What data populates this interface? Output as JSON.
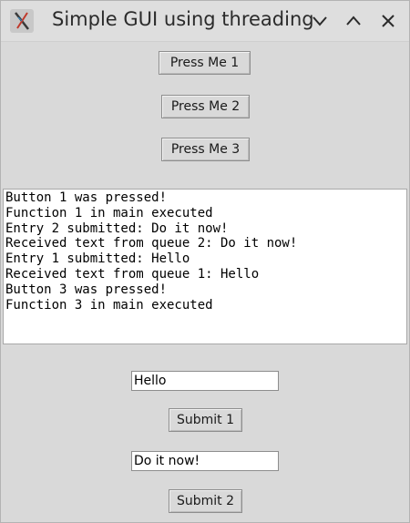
{
  "window": {
    "title": "Simple GUI using threading"
  },
  "buttons": {
    "press1": "Press Me 1",
    "press2": "Press Me 2",
    "press3": "Press Me 3",
    "submit1": "Submit 1",
    "submit2": "Submit 2"
  },
  "log": {
    "lines": [
      "Button 1 was pressed!",
      "Function 1 in main executed",
      "Entry 2 submitted: Do it now!",
      "Received text from queue 2: Do it now!",
      "Entry 1 submitted: Hello",
      "Received text from queue 1: Hello",
      "Button 3 was pressed!",
      "Function 3 in main executed"
    ]
  },
  "entries": {
    "entry1_value": "Hello",
    "entry2_value": "Do it now!"
  },
  "icons": {
    "app": "x-app-icon",
    "minimize": "chevron-down-icon",
    "maximize": "chevron-up-icon",
    "close": "close-icon"
  }
}
